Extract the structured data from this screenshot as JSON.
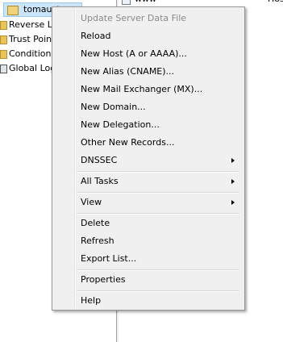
{
  "tree": {
    "zone_label": "tomaust",
    "items": [
      {
        "label": "Reverse Lo"
      },
      {
        "label": "Trust Point"
      },
      {
        "label": "Conditional"
      },
      {
        "label": "Global Log"
      }
    ]
  },
  "right_pane": {
    "name": "www",
    "type": "Hos"
  },
  "menu": {
    "update": "Update Server Data File",
    "reload": "Reload",
    "new_host": "New Host (A or AAAA)...",
    "new_alias": "New Alias (CNAME)...",
    "new_mx": "New Mail Exchanger (MX)...",
    "new_domain": "New Domain...",
    "new_delegation": "New Delegation...",
    "other_records": "Other New Records...",
    "dnssec": "DNSSEC",
    "all_tasks": "All Tasks",
    "view": "View",
    "delete": "Delete",
    "refresh": "Refresh",
    "export_list": "Export List...",
    "properties": "Properties",
    "help": "Help"
  }
}
